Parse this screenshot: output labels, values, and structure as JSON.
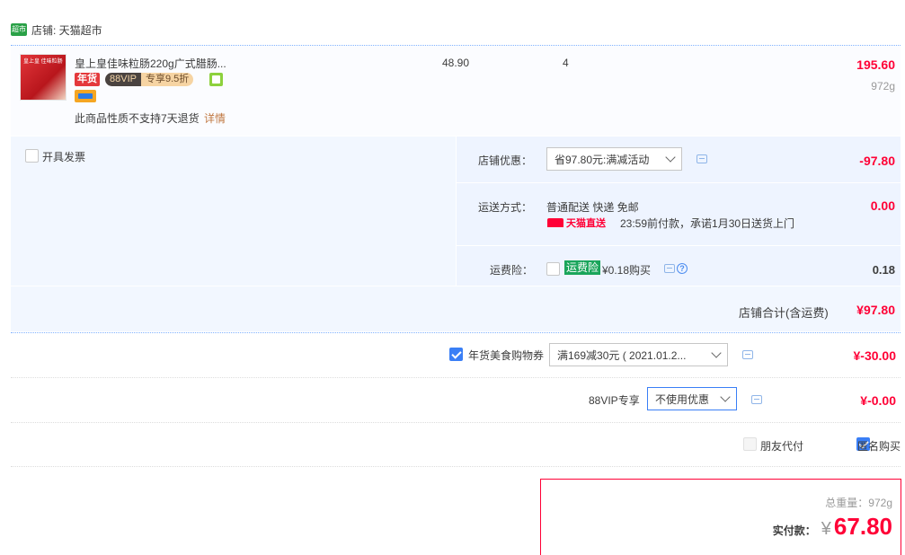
{
  "store": {
    "logo_text": "超市",
    "label": "店铺: 天猫超市"
  },
  "item": {
    "title": "皇上皇佳味粒肠220g广式腊肠...",
    "thumb_text": "皇上皇 佳味粒肠",
    "badge_nianhuo": "年货",
    "vip_left": "88VIP",
    "vip_right": "专享9.5折",
    "price": "48.90",
    "qty": "4",
    "total": "195.60",
    "weight": "972g",
    "note": "此商品性质不支持7天退货",
    "note_link": "详情"
  },
  "invoice": {
    "label": "开具发票"
  },
  "shop_discount": {
    "label": "店铺优惠：",
    "option": "省97.80元:满减活动",
    "value": "-97.80"
  },
  "shipping": {
    "label": "运送方式：",
    "method": "普通配送 快递 免邮",
    "tmall_badge": "天猫直送",
    "promise": "23:59前付款，承诺1月30日送货上门",
    "value": "0.00"
  },
  "insurance": {
    "label": "运费险：",
    "tag": "运费险",
    "price": "¥0.18购买",
    "question": "?",
    "value": "0.18"
  },
  "store_total": {
    "label": "店铺合计(含运费)",
    "value": "¥97.80"
  },
  "coupon": {
    "label": "年货美食购物券",
    "option": "满169减30元 ( 2021.01.2...",
    "value": "¥-30.00"
  },
  "vip88": {
    "label": "88VIP专享",
    "option": "不使用优惠",
    "value": "¥-0.00"
  },
  "friend_pay": {
    "label": "朋友代付"
  },
  "anonymous": {
    "label": "匿名购买"
  },
  "summary": {
    "weight": "总重量：972g",
    "pay_label": "实付款：",
    "yen": "¥",
    "amount": "67.80"
  },
  "colors": {
    "accent_red": "#ff0036",
    "accent_blue": "#3a7ff6",
    "tmall_green": "#1aa55b"
  }
}
